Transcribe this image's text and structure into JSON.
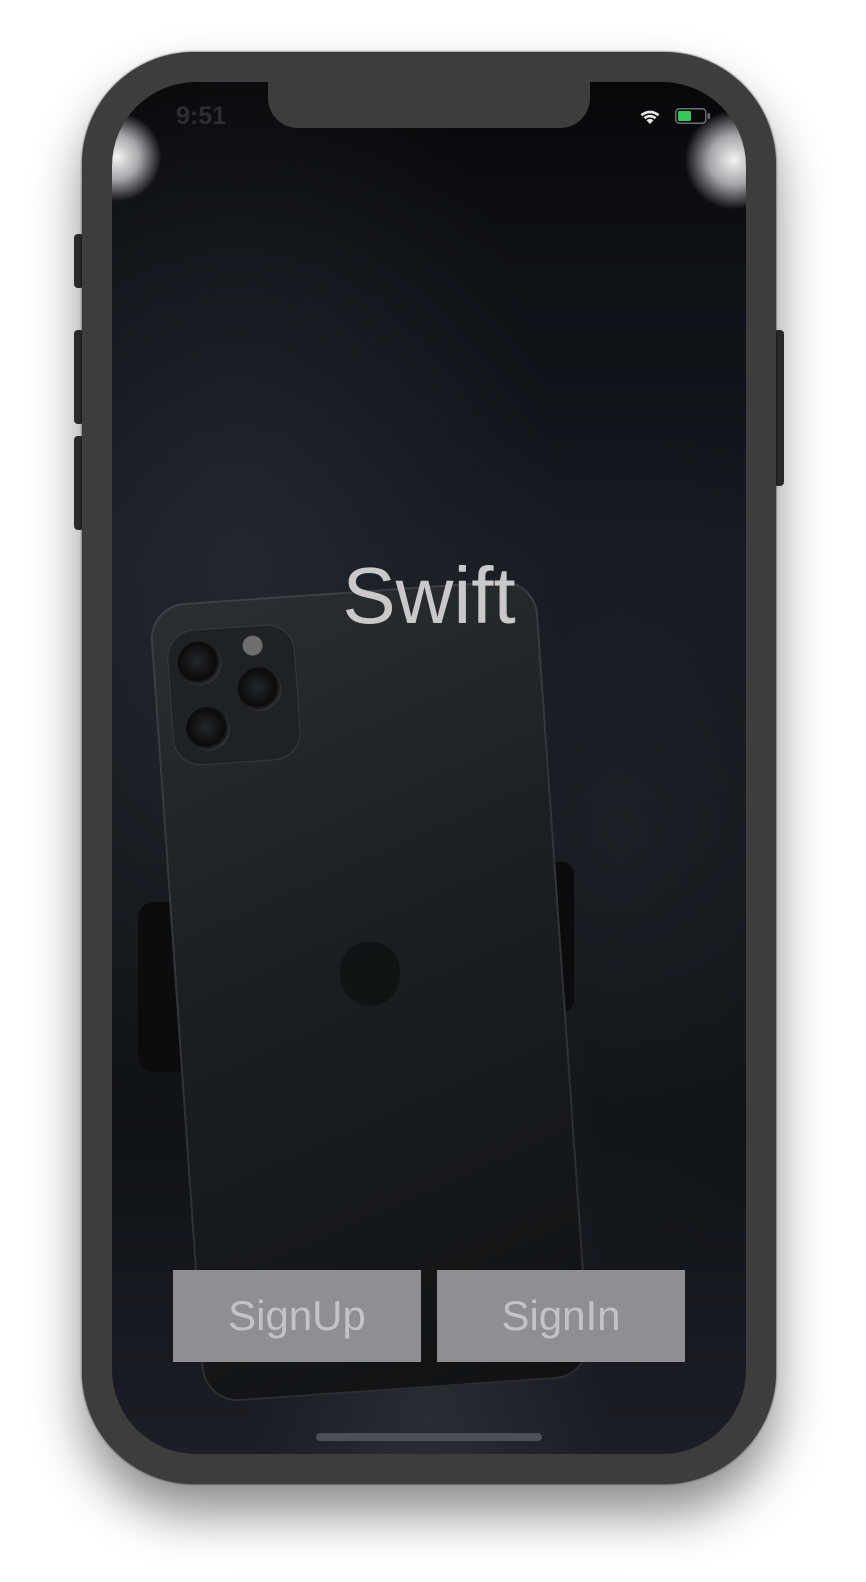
{
  "status_bar": {
    "time": "9:51"
  },
  "app": {
    "title": "Swift"
  },
  "buttons": {
    "signup_label": "SignUp",
    "signin_label": "SignIn"
  },
  "colors": {
    "button_bg": "#8e8e93",
    "button_text": "#c3c3c7",
    "title_text": "#c9c9cc",
    "battery_green": "#34c759"
  },
  "icons": {
    "wifi": "wifi-icon",
    "battery": "battery-icon"
  }
}
